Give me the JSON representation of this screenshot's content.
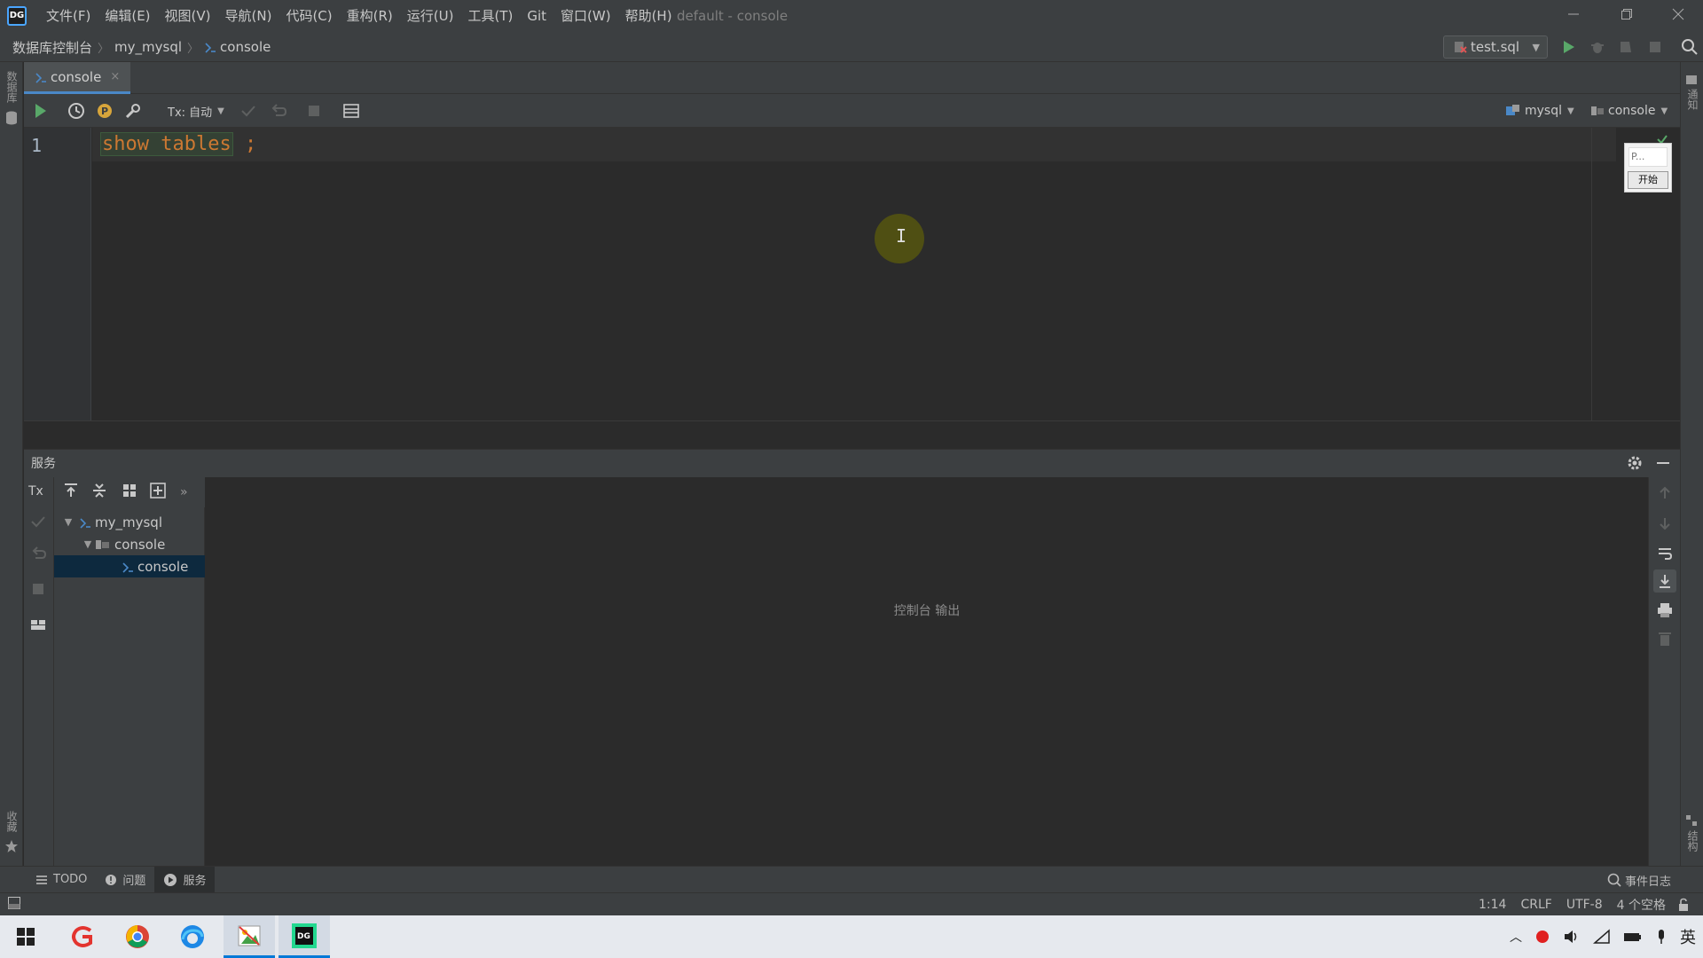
{
  "titlebar": {
    "menu": [
      "文件(F)",
      "编辑(E)",
      "视图(V)",
      "导航(N)",
      "代码(C)",
      "重构(R)",
      "运行(U)",
      "工具(T)",
      "Git",
      "窗口(W)",
      "帮助(H)"
    ],
    "window_title": "default - console"
  },
  "breadcrumb": [
    "数据库控制台",
    "my_mysql",
    "console"
  ],
  "run_config": "test.sql",
  "editor_tab": {
    "label": "console",
    "close": "×"
  },
  "toolbar": {
    "tx_mode": "Tx: 自动",
    "datasource": "mysql",
    "schema": "console"
  },
  "editor": {
    "line_number": "1",
    "keyword": "show tables",
    "terminator": ";",
    "cursor_glyph": "I"
  },
  "popup": {
    "input": "P...",
    "button": "开始"
  },
  "services": {
    "title": "服务",
    "tx_label": "Tx",
    "more": "»",
    "tree": [
      {
        "label": "my_mysql",
        "expanded": true,
        "level": 0
      },
      {
        "label": "console",
        "expanded": true,
        "level": 1
      },
      {
        "label": "console",
        "expanded": false,
        "level": 2,
        "selected": true
      }
    ],
    "output_placeholder": "控制台 输出"
  },
  "sidebar": {
    "left_top": "数据库",
    "left_bottom": "收藏",
    "right_top": "通知",
    "right_bottom": "结构"
  },
  "bottom_tabs": [
    "TODO",
    "问题",
    "服务"
  ],
  "event_log": "事件日志",
  "status": {
    "position": "1:14",
    "line_sep": "CRLF",
    "encoding": "UTF-8",
    "indent": "4 个空格"
  },
  "taskbar": {
    "ime": "英",
    "datagrip_label": "DG"
  },
  "colors": {
    "accent": "#4a88c7",
    "run_green": "#59a869",
    "keyword": "#cc7832"
  }
}
